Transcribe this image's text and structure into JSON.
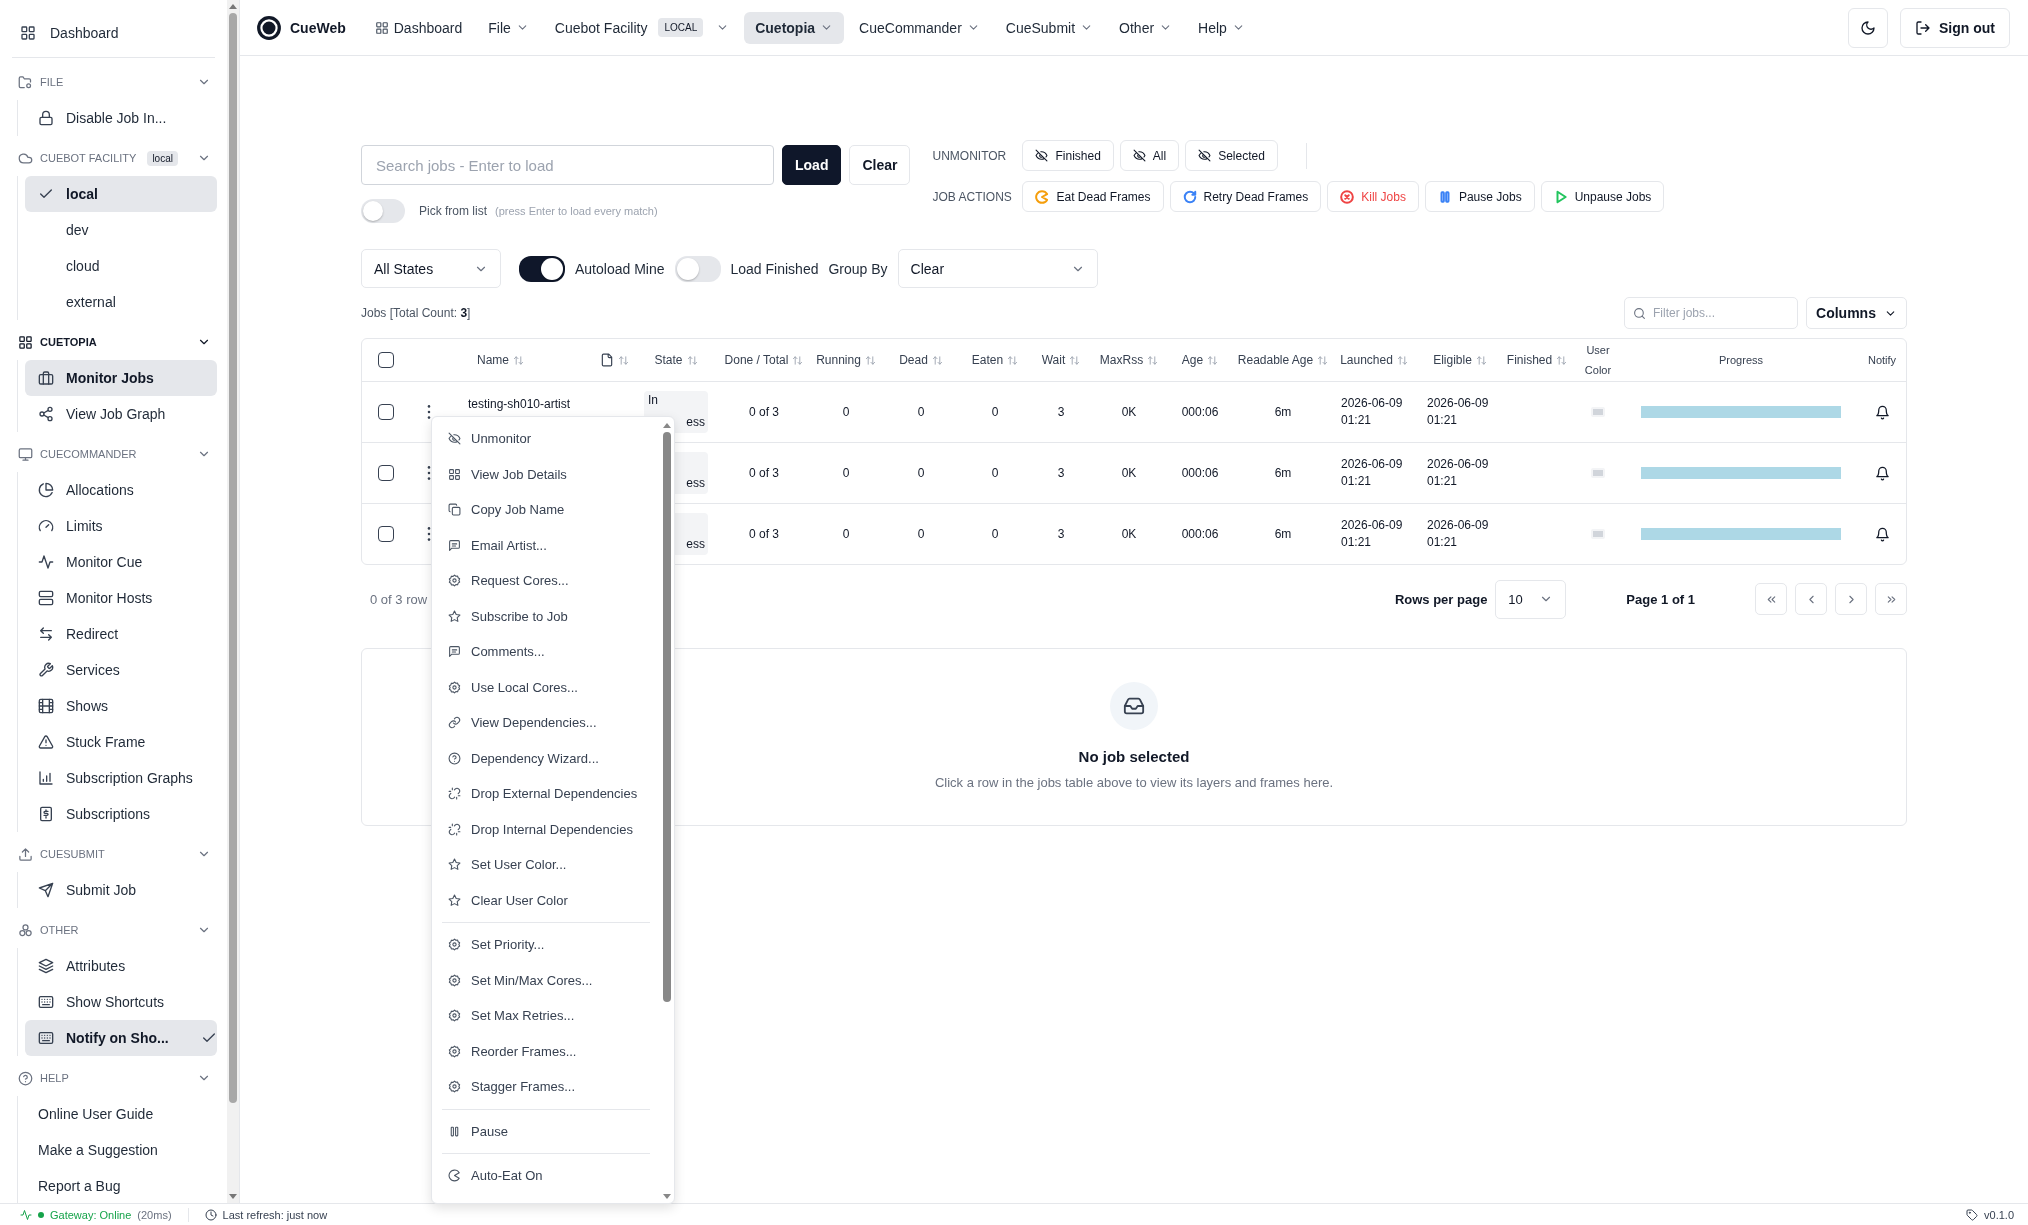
{
  "app": {
    "name": "CueWeb"
  },
  "nav": [
    {
      "label": "Dashboard",
      "kind": "link",
      "selected": false
    },
    {
      "label": "File",
      "kind": "menu",
      "selected": false
    },
    {
      "label": "Cuebot Facility",
      "kind": "facility",
      "badge": "LOCAL",
      "selected": false
    },
    {
      "label": "Cuetopia",
      "kind": "menu",
      "selected": true
    },
    {
      "label": "CueCommander",
      "kind": "menu",
      "selected": false
    },
    {
      "label": "CueSubmit",
      "kind": "menu",
      "selected": false
    },
    {
      "label": "Other",
      "kind": "menu",
      "selected": false
    },
    {
      "label": "Help",
      "kind": "menu",
      "selected": false
    }
  ],
  "sign_out": "Sign out",
  "sidebar": {
    "dashboard": "Dashboard",
    "sections": [
      {
        "title": "FILE",
        "active": false,
        "expanded": true,
        "items": [
          {
            "label": "Disable Job In...",
            "selected": false
          }
        ]
      },
      {
        "title": "CUEBOT FACILITY",
        "badge": "local",
        "active": false,
        "expanded": true,
        "items": [
          {
            "label": "local",
            "selected": true,
            "checked": true
          },
          {
            "label": "dev",
            "selected": false,
            "checked": false
          },
          {
            "label": "cloud",
            "selected": false,
            "checked": false
          },
          {
            "label": "external",
            "selected": false,
            "checked": false
          }
        ]
      },
      {
        "title": "CUETOPIA",
        "active": true,
        "expanded": true,
        "items": [
          {
            "label": "Monitor Jobs",
            "selected": true
          },
          {
            "label": "View Job Graph",
            "selected": false
          }
        ]
      },
      {
        "title": "CUECOMMANDER",
        "active": false,
        "expanded": true,
        "items": [
          {
            "label": "Allocations",
            "selected": false
          },
          {
            "label": "Limits",
            "selected": false
          },
          {
            "label": "Monitor Cue",
            "selected": false
          },
          {
            "label": "Monitor Hosts",
            "selected": false
          },
          {
            "label": "Redirect",
            "selected": false
          },
          {
            "label": "Services",
            "selected": false
          },
          {
            "label": "Shows",
            "selected": false
          },
          {
            "label": "Stuck Frame",
            "selected": false
          },
          {
            "label": "Subscription Graphs",
            "selected": false
          },
          {
            "label": "Subscriptions",
            "selected": false
          }
        ]
      },
      {
        "title": "CUESUBMIT",
        "active": false,
        "expanded": true,
        "items": [
          {
            "label": "Submit Job",
            "selected": false
          }
        ]
      },
      {
        "title": "OTHER",
        "active": false,
        "expanded": true,
        "items": [
          {
            "label": "Attributes",
            "selected": false,
            "checked": false
          },
          {
            "label": "Show Shortcuts",
            "selected": false,
            "checked": false
          },
          {
            "label": "Notify on Sho...",
            "selected": true,
            "checked": true
          }
        ]
      },
      {
        "title": "HELP",
        "active": false,
        "expanded": true,
        "items": [
          {
            "label": "Online User Guide",
            "selected": false
          },
          {
            "label": "Make a Suggestion",
            "selected": false
          },
          {
            "label": "Report a Bug",
            "selected": false
          }
        ]
      }
    ]
  },
  "search": {
    "placeholder": "Search jobs - Enter to load",
    "load": "Load",
    "clear": "Clear"
  },
  "pick": {
    "on": false,
    "label": "Pick from list",
    "hint": "(press Enter to load every match)"
  },
  "unmonitor": {
    "label": "UNMONITOR",
    "buttons": [
      "Finished",
      "All",
      "Selected"
    ]
  },
  "job_actions": {
    "label": "JOB ACTIONS",
    "buttons": [
      {
        "label": "Eat Dead Frames",
        "color": "#f59e0b",
        "kind": "normal"
      },
      {
        "label": "Retry Dead Frames",
        "color": "#3b82f6",
        "kind": "normal"
      },
      {
        "label": "Kill Jobs",
        "color": "#ef4444",
        "kind": "danger"
      },
      {
        "label": "Pause Jobs",
        "color": "#3b82f6",
        "kind": "normal"
      },
      {
        "label": "Unpause Jobs",
        "color": "#22c55e",
        "kind": "normal"
      }
    ]
  },
  "filters": {
    "state": "All States",
    "autoload": {
      "label": "Autoload Mine",
      "on": true
    },
    "load_finished": {
      "label": "Load Finished",
      "on": false
    },
    "group_by_label": "Group By",
    "group_by": "Clear"
  },
  "count": "Jobs [Total Count: **3**]",
  "filter": {
    "placeholder": "Filter jobs..."
  },
  "columns_button": "Columns",
  "table": {
    "select_all": false,
    "columns": [
      {
        "kind": "select"
      },
      {
        "label": "Name",
        "sortable": true
      },
      {
        "kind": "file",
        "sortable": true
      },
      {
        "label": "State",
        "sortable": true
      },
      {
        "label": "Done / Total",
        "sortable": true
      },
      {
        "label": "Running",
        "sortable": true
      },
      {
        "label": "Dead",
        "sortable": true
      },
      {
        "label": "Eaten",
        "sortable": true
      },
      {
        "label": "Wait",
        "sortable": true
      },
      {
        "label": "MaxRss",
        "sortable": true
      },
      {
        "label": "Age",
        "sortable": true
      },
      {
        "label": "Readable Age",
        "sortable": true
      },
      {
        "label": "Launched",
        "sortable": true
      },
      {
        "label": "Eligible",
        "sortable": true
      },
      {
        "label": "Finished",
        "sortable": true
      },
      {
        "label": "User Color",
        "sortable": false
      },
      {
        "label": "Progress",
        "sortable": false
      },
      {
        "label": "Notify",
        "sortable": false
      }
    ],
    "rows": [
      {
        "selected": false,
        "level": 1,
        "name": "testing-sh010-artist",
        "state": [
          "In",
          "ess"
        ],
        "values": [
          "0 of 3",
          "0",
          "0",
          "0",
          "3",
          "0K",
          "000:06",
          "6m",
          "2026-06-09 01:21",
          "2026-06-09 01:21"
        ]
      },
      {
        "selected": false,
        "level": 1,
        "state": [
          "ess"
        ],
        "values": [
          "0 of 3",
          "0",
          "0",
          "0",
          "3",
          "0K",
          "000:06",
          "6m",
          "2026-06-09 01:21",
          "2026-06-09 01:21"
        ]
      },
      {
        "selected": false,
        "level": 1,
        "state": [
          "ess"
        ],
        "values": [
          "0 of 3",
          "0",
          "0",
          "0",
          "3",
          "0K",
          "000:06",
          "6m",
          "2026-06-09 01:21",
          "2026-06-09 01:21"
        ]
      }
    ]
  },
  "pagination": {
    "summary": "0 of 3 row",
    "rows_label": "Rows per page",
    "rows": "10",
    "page": "Page 1 of 1"
  },
  "empty": {
    "title": "No job selected",
    "text": "Click a row in the jobs table above to view its layers and frames here."
  },
  "context_menu": {
    "groups": [
      [
        "Unmonitor",
        "View Job Details",
        "Copy Job Name",
        "Email Artist...",
        "Request Cores...",
        "Subscribe to Job",
        "Comments...",
        "Use Local Cores...",
        "View Dependencies...",
        "Dependency Wizard...",
        "Drop External Dependencies",
        "Drop Internal Dependencies",
        "Set User Color...",
        "Clear User Color"
      ],
      [
        "Set Priority...",
        "Set Min/Max Cores...",
        "Set Max Retries...",
        "Reorder Frames...",
        "Stagger Frames..."
      ],
      [
        "Pause"
      ],
      [
        "Auto-Eat On"
      ]
    ]
  },
  "status": {
    "online": true,
    "gateway": "Gateway: Online",
    "latency": "(20ms)",
    "refresh": "Last refresh: just now",
    "version": "v0.1.0"
  }
}
